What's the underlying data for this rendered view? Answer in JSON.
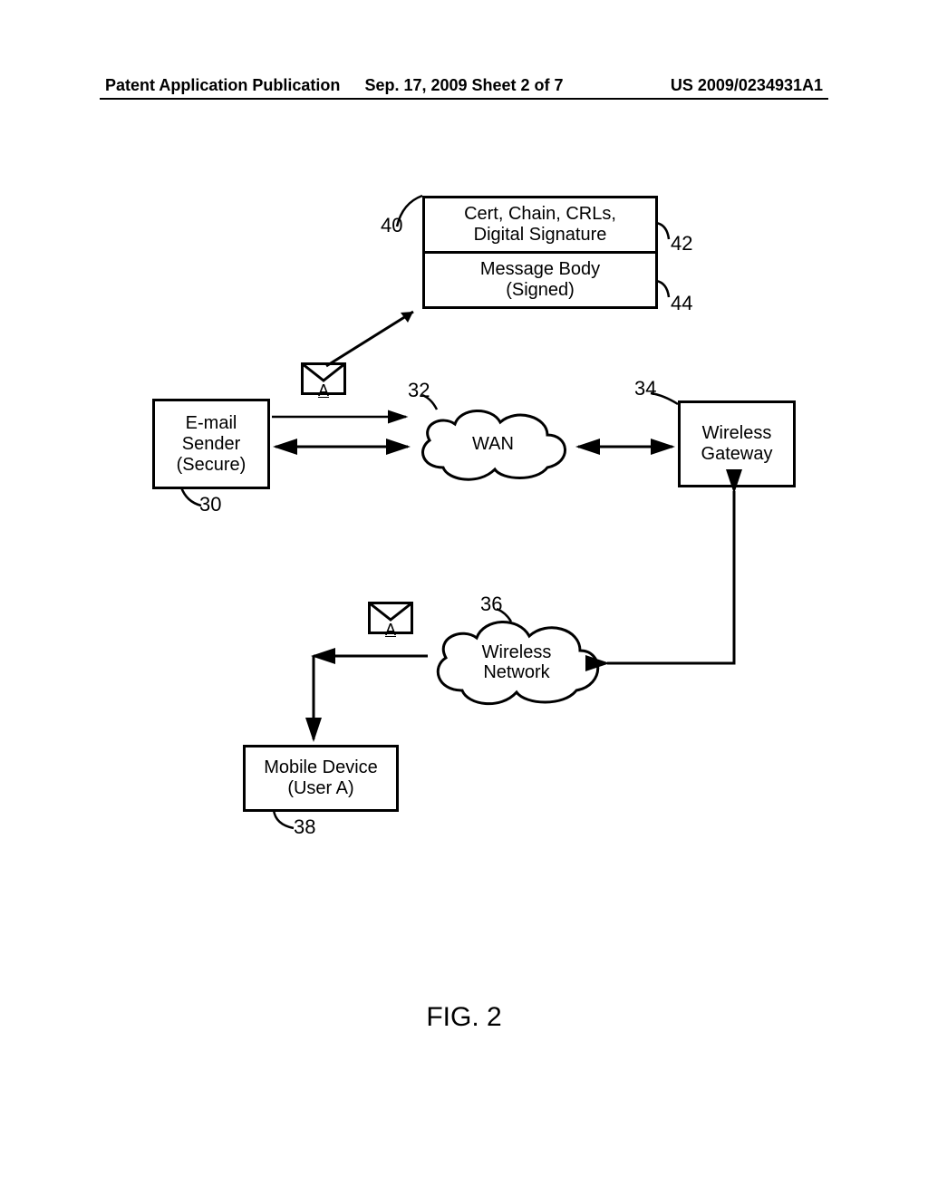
{
  "header": {
    "left": "Patent Application Publication",
    "center": "Sep. 17, 2009  Sheet 2 of 7",
    "right": "US 2009/0234931A1"
  },
  "figure_label": "FIG. 2",
  "nodes": {
    "sender": {
      "line1": "E-mail",
      "line2": "Sender",
      "line3": "(Secure)",
      "ref": "30"
    },
    "wan": {
      "label": "WAN",
      "ref": "32"
    },
    "gateway": {
      "line1": "Wireless",
      "line2": "Gateway",
      "ref": "34"
    },
    "wnet": {
      "line1": "Wireless",
      "line2": "Network",
      "ref": "36"
    },
    "mobile": {
      "line1": "Mobile Device",
      "line2": "(User A)",
      "ref": "38"
    }
  },
  "message": {
    "ref": "40",
    "row1": {
      "line1": "Cert, Chain, CRLs,",
      "line2": "Digital Signature",
      "ref": "42"
    },
    "row2": {
      "line1": "Message Body",
      "line2": "(Signed)",
      "ref": "44"
    }
  },
  "envelope": {
    "label": "A"
  }
}
